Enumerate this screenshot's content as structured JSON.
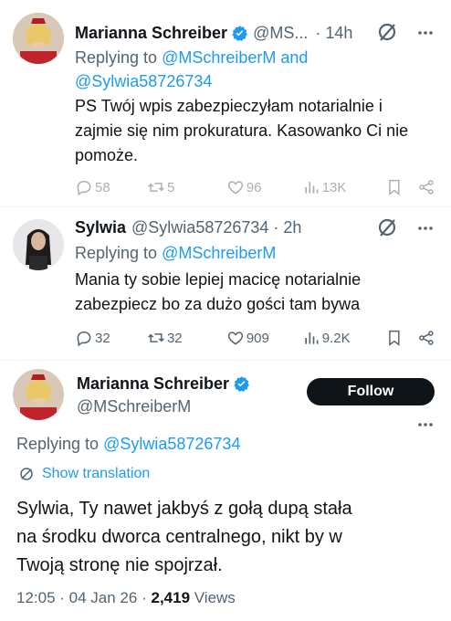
{
  "tweet1": {
    "author_name": "Marianna Schreiber",
    "handle_truncated": "@MS...",
    "time": "· 14h",
    "replying_prefix": "Replying to",
    "replying_user1": "@MSchreiberM",
    "replying_and": "and",
    "replying_user2": "@Sylwia58726734",
    "text_line1": "PS Twój wpis zabezpieczyłam notarialnie i",
    "text_line2": "zajmie się nim prokuratura. Kasowanko Ci nie",
    "text_line3": "pomoże.",
    "replies": "58",
    "retweets": "5",
    "likes": "96",
    "views": "13K"
  },
  "tweet2": {
    "author_name": "Sylwia",
    "handle": "@Sylwia58726734",
    "time": "· 2h",
    "replying_prefix": "Replying to",
    "replying_user": "@MSchreiberM",
    "text_line1": "Mania ty sobie lepiej macicę notarialnie",
    "text_line2": "zabezpiecz bo za dużo gości tam bywa",
    "replies": "32",
    "retweets": "32",
    "likes": "909",
    "views": "9.2K"
  },
  "main_tweet": {
    "author_name": "Marianna Schreiber",
    "handle": "@MSchreiberM",
    "follow_label": "Follow",
    "replying_prefix": "Replying to",
    "replying_user": "@Sylwia58726734",
    "show_translation": "Show translation",
    "text_line1": "Sylwia, Ty nawet jakbyś z gołą dupą stała",
    "text_line2": "na środku dworca centralnego, nikt by w",
    "text_line3": "Twoją stronę nie spojrzał.",
    "time": "12:05",
    "date": "04 Jan 26",
    "views_count": "2,419",
    "views_label": "Views"
  },
  "colors": {
    "accent": "#1d9bf0",
    "muted": "#536471",
    "text": "#0f1419"
  }
}
